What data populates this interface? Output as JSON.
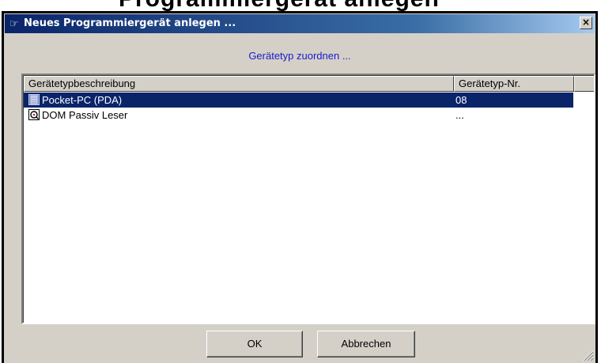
{
  "window": {
    "title": "Neues Programmiergerät anlegen ...",
    "close_label": "×"
  },
  "background_text": "Programmiergerät anlegen",
  "heading": "Gerätetyp zuordnen ...",
  "listview": {
    "columns": [
      "Gerätetypbeschreibung",
      "Gerätetyp-Nr."
    ],
    "rows": [
      {
        "description": "Pocket-PC (PDA)",
        "number": "08",
        "icon": "pda-icon",
        "selected": true
      },
      {
        "description": "DOM Passiv Leser",
        "number": "...",
        "icon": "reader-icon",
        "selected": false
      }
    ]
  },
  "buttons": {
    "ok_label": "OK",
    "cancel_label": "Abbrechen"
  },
  "colors": {
    "title_bar": "#0a246a",
    "selection": "#0a246a",
    "heading_text": "#1a1acc",
    "dialog_face": "#d4d0c8"
  }
}
